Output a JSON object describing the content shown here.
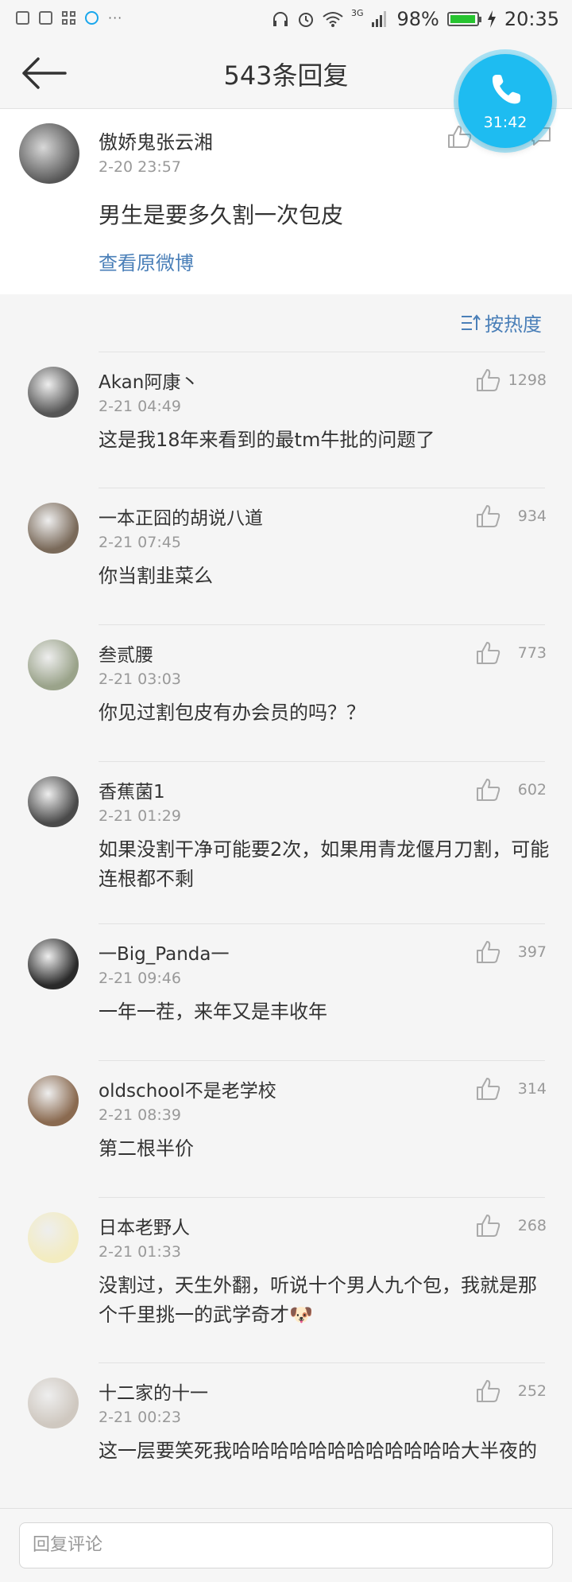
{
  "status_bar": {
    "network": "3G",
    "battery_percent": "98%",
    "battery_level": 0.98,
    "time": "20:35",
    "more": "···"
  },
  "header": {
    "title": "543条回复"
  },
  "call_bubble": {
    "duration": "31:42"
  },
  "original_post": {
    "author": "傲娇鬼张云湘",
    "time": "2-20 23:57",
    "text": "男生是要多久割一次包皮",
    "link_label": "查看原微博"
  },
  "sort": {
    "label": "按热度"
  },
  "comments": [
    {
      "author": "Akan阿康丶",
      "time": "2-21 04:49",
      "text": "这是我18年来看到的最tm牛批的问题了",
      "likes": "1298",
      "avatar_color": "#555555"
    },
    {
      "author": "一本正囧的胡说八道",
      "time": "2-21 07:45",
      "text": "你当割韭菜么",
      "likes": "934",
      "avatar_color": "#7a6a5a"
    },
    {
      "author": "叁贰腰",
      "time": "2-21 03:03",
      "text": "你见过割包皮有办会员的吗？？",
      "likes": "773",
      "avatar_color": "#9aa38a"
    },
    {
      "author": "香蕉菌1",
      "time": "2-21 01:29",
      "text": "如果没割干净可能要2次，如果用青龙偃月刀割，可能连根都不剩",
      "likes": "602",
      "avatar_color": "#4a4a4a"
    },
    {
      "author": "一Big_Panda一",
      "time": "2-21 09:46",
      "text": "一年一茬，来年又是丰收年",
      "likes": "397",
      "avatar_color": "#2a2a2a"
    },
    {
      "author": "oldschool不是老学校",
      "time": "2-21 08:39",
      "text": "第二根半价",
      "likes": "314",
      "avatar_color": "#8a6a50"
    },
    {
      "author": "日本老野人",
      "time": "2-21 01:33",
      "text": "没割过，天生外翻，听说十个男人九个包，我就是那个千里挑一的武学奇才🐶",
      "likes": "268",
      "avatar_color": "#f3ecc0"
    },
    {
      "author": "十二家的十一",
      "time": "2-21 00:23",
      "text": "这一层要笑死我哈哈哈哈哈哈哈哈哈哈哈哈大半夜的",
      "likes": "252",
      "avatar_color": "#cfc8c0"
    }
  ],
  "reply_bar": {
    "placeholder": "回复评论"
  }
}
